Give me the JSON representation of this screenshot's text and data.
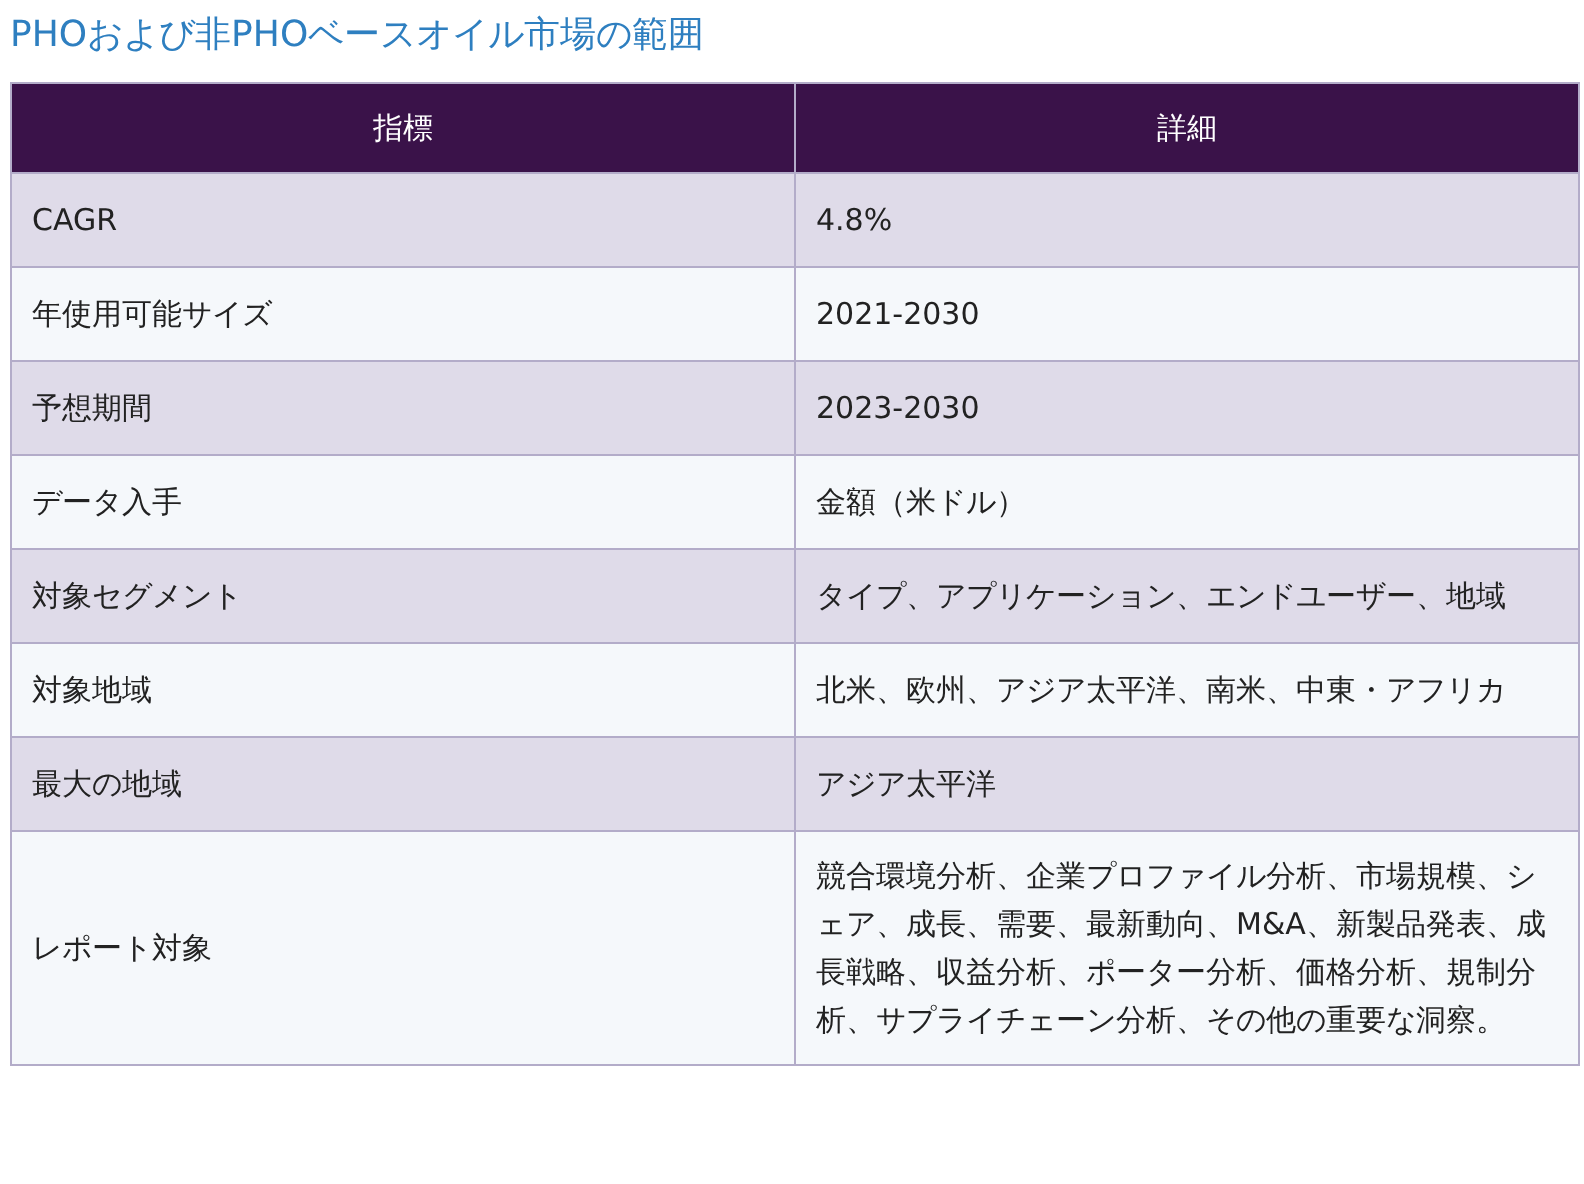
{
  "title": "PHOおよび非PHOベースオイル市場の範囲",
  "table": {
    "columns": [
      "指標",
      "詳細"
    ],
    "rows": [
      [
        "CAGR",
        "4.8%"
      ],
      [
        "年使用可能サイズ",
        "2021-2030"
      ],
      [
        "予想期間",
        "2023-2030"
      ],
      [
        "データ入手",
        "金額（米ドル）"
      ],
      [
        "対象セグメント",
        "タイプ、アプリケーション、エンドユーザー、地域"
      ],
      [
        "対象地域",
        "北米、欧州、アジア太平洋、南米、中東・アフリカ"
      ],
      [
        "最大の地域",
        "アジア太平洋"
      ],
      [
        "レポート対象",
        "競合環境分析、企業プロファイル分析、市場規模、シェア、成長、需要、最新動向、M&A、新製品発表、成長戦略、収益分析、ポーター分析、価格分析、規制分析、サプライチェーン分析、その他の重要な洞察。"
      ]
    ]
  }
}
